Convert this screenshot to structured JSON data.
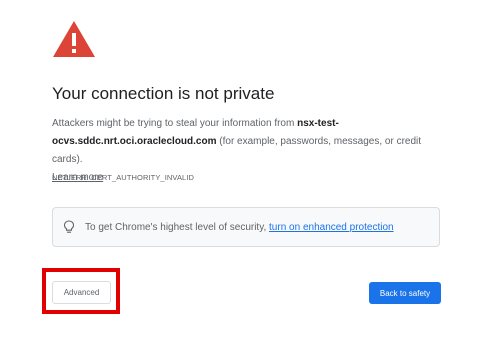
{
  "header": {
    "icon": "warning-triangle-icon",
    "icon_color": "#db4437",
    "title": "Your connection is not private"
  },
  "body": {
    "desc_before": "Attackers might be trying to steal your information from ",
    "hostname": "nsx-test-ocvs.sddc.nrt.oci.oraclecloud.com",
    "desc_after": " (for example, passwords, messages, or credit cards).",
    "learn_more": "Learn more",
    "error_code": "NET::ERR_CERT_AUTHORITY_INVALID"
  },
  "enhanced_protection": {
    "icon": "lightbulb-icon",
    "text": "To get Chrome's highest level of security, ",
    "link": "turn on enhanced protection"
  },
  "buttons": {
    "advanced": "Advanced",
    "back_to_safety": "Back to safety"
  },
  "colors": {
    "primary": "#1a73e8",
    "highlight": "#e00000",
    "text": "#5f6368",
    "heading": "#202124"
  }
}
